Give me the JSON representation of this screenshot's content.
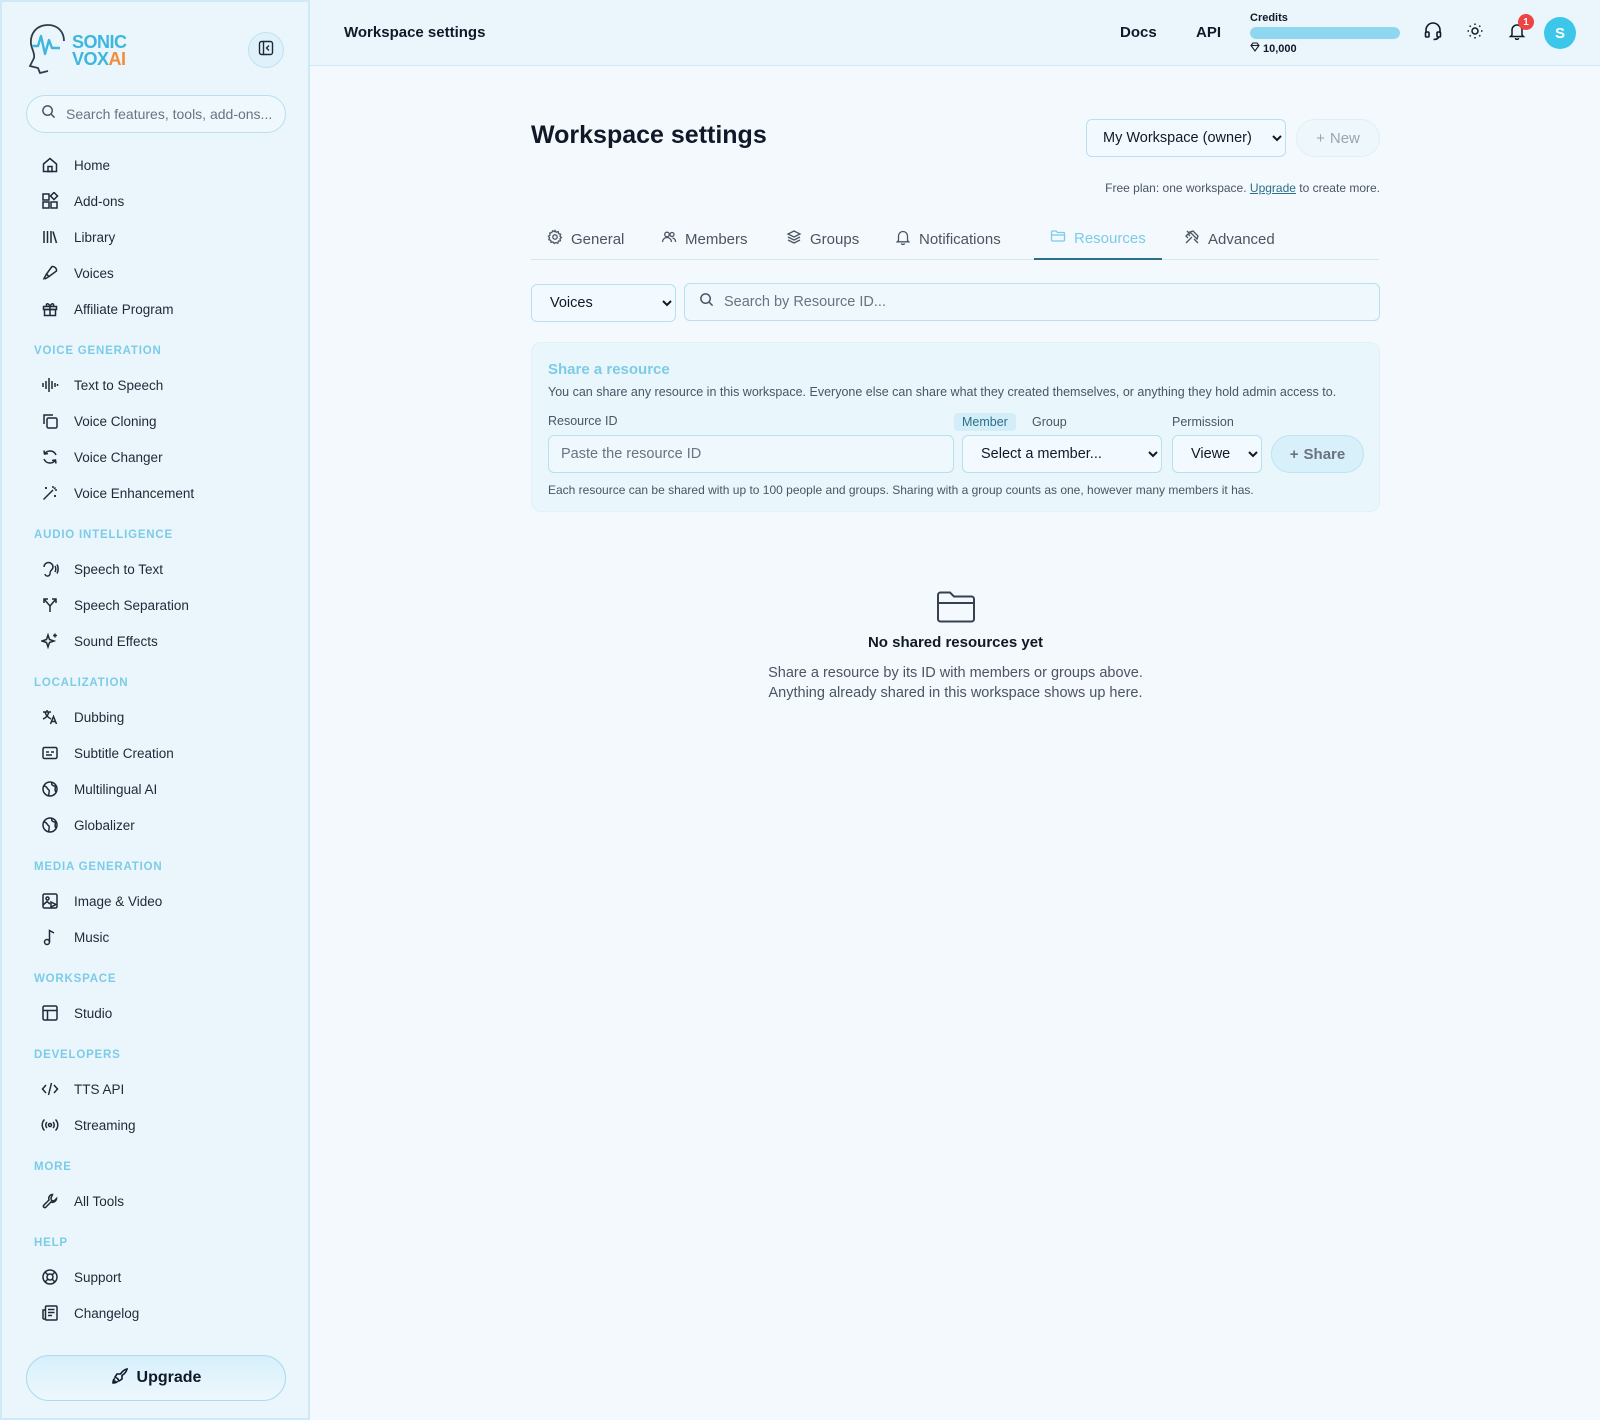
{
  "logo": {
    "line1": "SONIC",
    "line2": "VOX",
    "line2_accent": "AI"
  },
  "sidebar": {
    "search_placeholder": "Search features, tools, add-ons...",
    "items_top": [
      {
        "label": "Home",
        "icon": "home-icon"
      },
      {
        "label": "Add-ons",
        "icon": "puzzle-icon"
      },
      {
        "label": "Library",
        "icon": "library-icon"
      },
      {
        "label": "Voices",
        "icon": "voices-icon"
      },
      {
        "label": "Affiliate Program",
        "icon": "gift-icon"
      }
    ],
    "sections": {
      "voice_generation": "VOICE GENERATION",
      "audio_intelligence": "AUDIO INTELLIGENCE",
      "localization": "LOCALIZATION",
      "media_generation": "MEDIA GENERATION",
      "workspace": "WORKSPACE",
      "developers": "DEVELOPERS",
      "more": "MORE",
      "help": "HELP"
    },
    "voice_generation": [
      "Text to Speech",
      "Voice Cloning",
      "Voice Changer",
      "Voice Enhancement"
    ],
    "audio_intelligence": [
      "Speech to Text",
      "Speech Separation",
      "Sound Effects"
    ],
    "localization": [
      "Dubbing",
      "Subtitle Creation",
      "Multilingual AI",
      "Globalizer"
    ],
    "media_generation": [
      "Image & Video",
      "Music"
    ],
    "workspace": [
      "Studio"
    ],
    "developers": [
      "TTS API",
      "Streaming"
    ],
    "more": [
      "All Tools"
    ],
    "help": [
      "Support",
      "Changelog"
    ],
    "upgrade_label": "Upgrade"
  },
  "topbar": {
    "title": "Workspace settings",
    "docs": "Docs",
    "api": "API",
    "credits_label": "Credits",
    "credits_amount": "10,000",
    "credits_fill_fraction": 1.0,
    "notification_count": "1",
    "avatar_initial": "S"
  },
  "main": {
    "title": "Workspace settings",
    "workspace_selected": "My Workspace (owner)",
    "new_label": "New",
    "plan_note_prefix": "Free plan: one workspace.",
    "plan_note_link": "Upgrade",
    "plan_note_suffix": "to create more.",
    "tabs": [
      {
        "label": "General",
        "icon": "gear-icon"
      },
      {
        "label": "Members",
        "icon": "users-icon"
      },
      {
        "label": "Groups",
        "icon": "layers-icon"
      },
      {
        "label": "Notifications",
        "icon": "bell-icon"
      },
      {
        "label": "Resources",
        "icon": "folder-icon",
        "active": true
      },
      {
        "label": "Advanced",
        "icon": "tools-icon"
      }
    ],
    "filter_selected": "Voices",
    "search_placeholder": "Search by Resource ID...",
    "share": {
      "title": "Share a resource",
      "description": "You can share any resource in this workspace. Everyone else can share what they created themselves, or anything they hold admin access to.",
      "resource_id_label": "Resource ID",
      "resource_id_placeholder": "Paste the resource ID",
      "toggle_member": "Member",
      "toggle_group": "Group",
      "member_selected": "Select a member...",
      "permission_label": "Permission",
      "permission_selected": "Viewer",
      "share_label": "Share",
      "note": "Each resource can be shared with up to 100 people and groups. Sharing with a group counts as one, however many members it has."
    },
    "empty": {
      "title": "No shared resources yet",
      "line1": "Share a resource by its ID with members or groups above.",
      "line2": "Anything already shared in this workspace shows up here."
    }
  },
  "colors": {
    "accent": "#7ccce8",
    "brand_orange": "#f28b3a",
    "badge": "#ef4444",
    "avatar": "#3cc7ea"
  }
}
